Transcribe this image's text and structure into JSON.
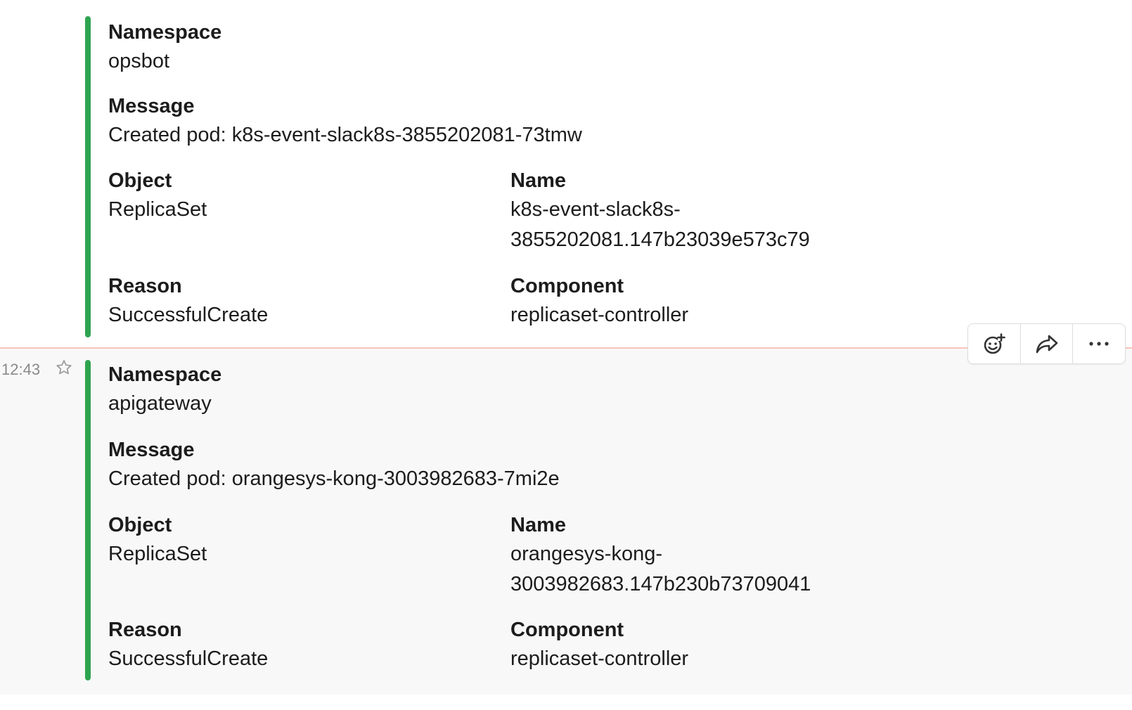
{
  "messages": [
    {
      "timestamp": "",
      "attachment": {
        "color": "#2ea44f",
        "namespace": {
          "title": "Namespace",
          "value": "opsbot"
        },
        "message": {
          "title": "Message",
          "value": "Created pod: k8s-event-slack8s-3855202081-73tmw"
        },
        "object": {
          "title": "Object",
          "value": "ReplicaSet"
        },
        "name": {
          "title": "Name",
          "value_line1": "k8s-event-slack8s-",
          "value_line2": "3855202081.147b23039e573c79"
        },
        "reason": {
          "title": "Reason",
          "value": "SuccessfulCreate"
        },
        "component": {
          "title": "Component",
          "value": "replicaset-controller"
        }
      }
    },
    {
      "timestamp": "12:43",
      "attachment": {
        "color": "#2ea44f",
        "namespace": {
          "title": "Namespace",
          "value": "apigateway"
        },
        "message": {
          "title": "Message",
          "value": "Created pod: orangesys-kong-3003982683-7mi2e"
        },
        "object": {
          "title": "Object",
          "value": "ReplicaSet"
        },
        "name": {
          "title": "Name",
          "value_line1": "orangesys-kong-",
          "value_line2": "3003982683.147b230b73709041"
        },
        "reason": {
          "title": "Reason",
          "value": "SuccessfulCreate"
        },
        "component": {
          "title": "Component",
          "value": "replicaset-controller"
        }
      }
    }
  ],
  "message_actions": {
    "icons": [
      "add-reaction-icon",
      "share-icon",
      "more-actions-icon"
    ]
  },
  "colors": {
    "attachment_bar": "#2ea44f",
    "new_message_divider": "#f7c4b9",
    "hover_background": "#f8f8f8",
    "timestamp": "#8a8a8a"
  }
}
